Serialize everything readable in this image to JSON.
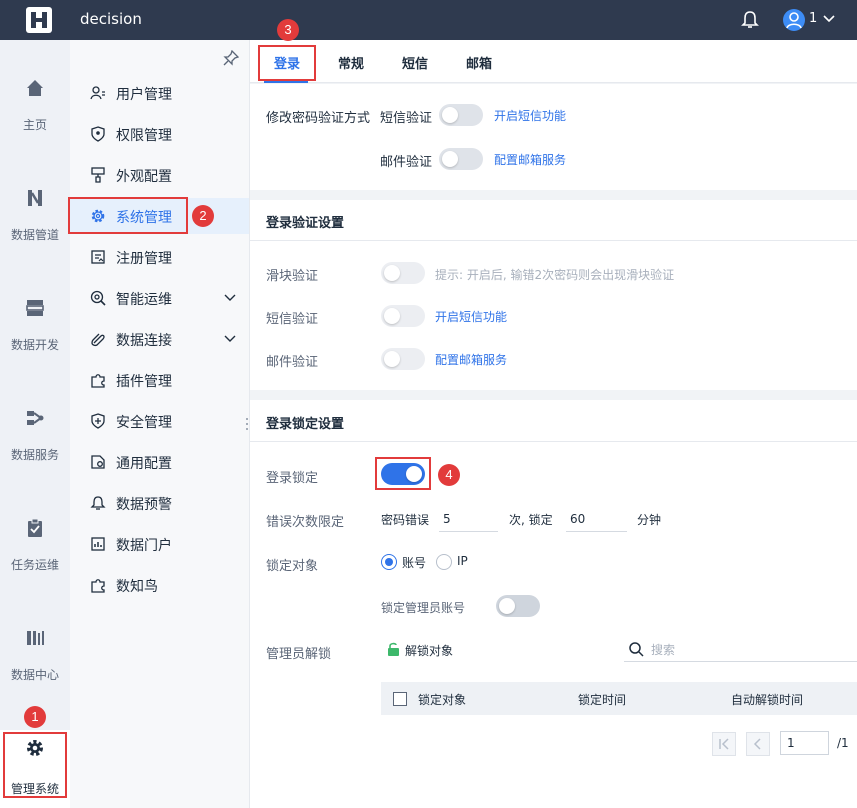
{
  "app": {
    "title": "decision",
    "user_label": "1"
  },
  "rail": {
    "items": [
      {
        "label": "主页",
        "icon": "home-icon"
      },
      {
        "label": "数据管道",
        "icon": "pipeline-icon"
      },
      {
        "label": "数据开发",
        "icon": "dev-icon"
      },
      {
        "label": "数据服务",
        "icon": "service-icon"
      },
      {
        "label": "任务运维",
        "icon": "task-icon"
      },
      {
        "label": "数据中心",
        "icon": "datacenter-icon"
      },
      {
        "label": "管理系统",
        "icon": "gear-icon"
      }
    ]
  },
  "subnav": {
    "items": [
      {
        "label": "用户管理",
        "icon": "user-icon"
      },
      {
        "label": "权限管理",
        "icon": "shield-icon"
      },
      {
        "label": "外观配置",
        "icon": "brush-icon"
      },
      {
        "label": "系统管理",
        "icon": "gear-icon"
      },
      {
        "label": "注册管理",
        "icon": "register-icon"
      },
      {
        "label": "智能运维",
        "icon": "ops-icon"
      },
      {
        "label": "数据连接",
        "icon": "link-icon"
      },
      {
        "label": "插件管理",
        "icon": "plugin-icon"
      },
      {
        "label": "安全管理",
        "icon": "security-icon"
      },
      {
        "label": "通用配置",
        "icon": "config-icon"
      },
      {
        "label": "数据预警",
        "icon": "bell-icon"
      },
      {
        "label": "数据门户",
        "icon": "portal-icon"
      },
      {
        "label": "数知鸟",
        "icon": "bird-icon"
      }
    ]
  },
  "tabs": [
    "登录",
    "常规",
    "短信",
    "邮箱"
  ],
  "password_section": {
    "label": "修改密码验证方式",
    "sms_label": "短信验证",
    "sms_link": "开启短信功能",
    "mail_label": "邮件验证",
    "mail_link": "配置邮箱服务"
  },
  "login_verify": {
    "title": "登录验证设置",
    "slider_label": "滑块验证",
    "slider_hint": "提示: 开启后, 输错2次密码则会出现滑块验证",
    "sms_label": "短信验证",
    "sms_link": "开启短信功能",
    "mail_label": "邮件验证",
    "mail_link": "配置邮箱服务"
  },
  "login_lock": {
    "title": "登录锁定设置",
    "lock_label": "登录锁定",
    "lock_enabled": true,
    "error_label": "错误次数限定",
    "error_prefix": "密码错误",
    "error_count": "5",
    "error_mid": "次, 锁定",
    "lock_minutes": "60",
    "error_suffix": "分钟",
    "target_label": "锁定对象",
    "target_options": [
      "账号",
      "IP"
    ],
    "target_selected": "账号",
    "admin_lock_label": "锁定管理员账号",
    "unlock_label": "管理员解锁",
    "unlock_button": "解锁对象",
    "search_placeholder": "搜索",
    "table_headers": [
      "锁定对象",
      "锁定时间",
      "自动解锁时间"
    ],
    "page_value": "1",
    "page_total": "/1"
  },
  "annotations": [
    "1",
    "2",
    "3",
    "4"
  ],
  "colors": {
    "accent": "#2f73e8",
    "topbar": "#2f3a4f",
    "annotation": "#e23b3b"
  }
}
